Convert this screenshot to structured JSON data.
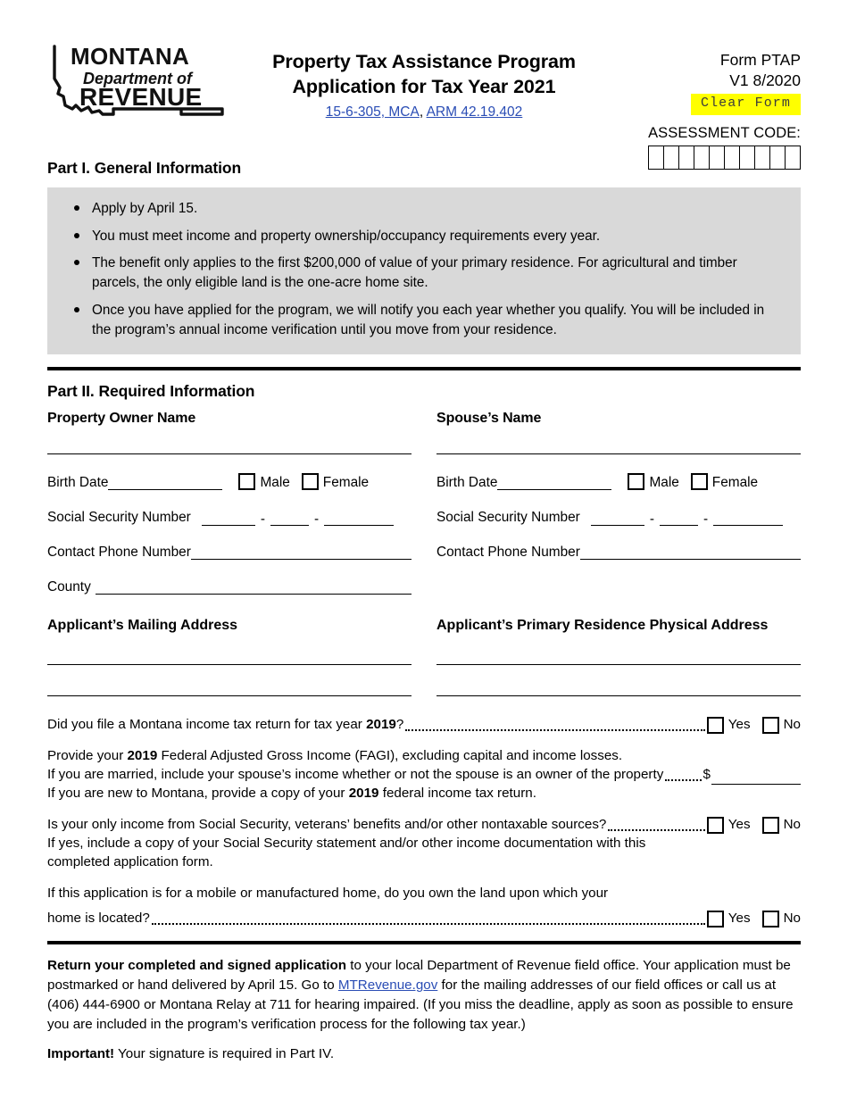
{
  "header": {
    "logo": {
      "line1": "MONTANA",
      "line2": "Department of",
      "line3": "REVENUE"
    },
    "title_line1": "Property Tax Assistance Program",
    "title_line2": "Application for Tax Year 2021",
    "citation1": "15-6-305, MCA",
    "citation_sep": ", ",
    "citation2": "ARM 42.19.402",
    "form_id": "Form PTAP",
    "version": "V1 8/2020",
    "clear_form_label": "Clear Form",
    "assessment_code_label": "ASSESSMENT CODE:",
    "assessment_code_cells": 10,
    "highlight_color": "#ffff00",
    "link_color": "#2a4db5"
  },
  "part1": {
    "heading": "Part I. General Information",
    "bullets": [
      "Apply by April 15.",
      "You must meet income and property ownership/occupancy requirements every year.",
      "The benefit only applies to the first $200,000 of value of your primary residence. For agricultural and timber parcels, the only eligible land is the one-acre home site.",
      "Once you have applied for the program, we will notify you each year whether you qualify. You will be included in the program’s annual income verification until you move from your residence."
    ],
    "background_color": "#d9d9d9"
  },
  "part2": {
    "heading": "Part II. Required Information",
    "owner": {
      "name_label": "Property Owner Name",
      "birth_date_label": "Birth Date",
      "male_label": "Male",
      "female_label": "Female",
      "ssn_label": "Social Security Number",
      "phone_label": "Contact Phone Number",
      "county_label": "County",
      "address_heading": "Applicant’s Mailing Address"
    },
    "spouse": {
      "name_label": "Spouse’s Name",
      "birth_date_label": "Birth Date",
      "male_label": "Male",
      "female_label": "Female",
      "ssn_label": "Social Security Number",
      "phone_label": "Contact Phone Number",
      "address_heading": "Applicant’s Primary Residence Physical Address"
    },
    "questions": {
      "q1_a": "Did you file a Montana income tax return for tax year ",
      "q1_bold": "2019",
      "q1_b": "?",
      "q2_line1_a": "Provide your ",
      "q2_line1_bold": "2019",
      "q2_line1_b": " Federal Adjusted Gross Income (FAGI), excluding capital and income losses.",
      "q2_line2": "If you are married, include your spouse’s income whether or not the spouse is an owner of the property",
      "q2_dollar": "$",
      "q2_line3_a": "If you are new to Montana, provide a copy of your ",
      "q2_line3_bold": "2019",
      "q2_line3_b": " federal income tax return.",
      "q3": "Is your only income from Social Security, veterans’ benefits and/or other nontaxable sources?",
      "q3_sub_line1": "If yes, include a copy of your Social Security statement and/or other income documentation with this",
      "q3_sub_line2": "completed application form.",
      "q4_line1": "If this application is for a mobile or manufactured home, do you own the land upon which your",
      "q4_line2": "home is located?",
      "yes_label": "Yes",
      "no_label": "No"
    }
  },
  "footer": {
    "p1_bold": "Return your completed and signed application",
    "p1_a": " to your local Department of Revenue field office. Your application must be postmarked or hand delivered by April 15. Go to ",
    "p1_link": "MTRevenue.gov",
    "p1_b": " for the mailing addresses of our field offices or call us at (406) 444-6900 or Montana Relay at 711 for hearing impaired. (If you miss the deadline, apply as soon as possible to ensure you are included in the program’s verification process for the following tax year.)",
    "p2_bold": "Important!",
    "p2_text": " Your signature is required in Part IV."
  }
}
